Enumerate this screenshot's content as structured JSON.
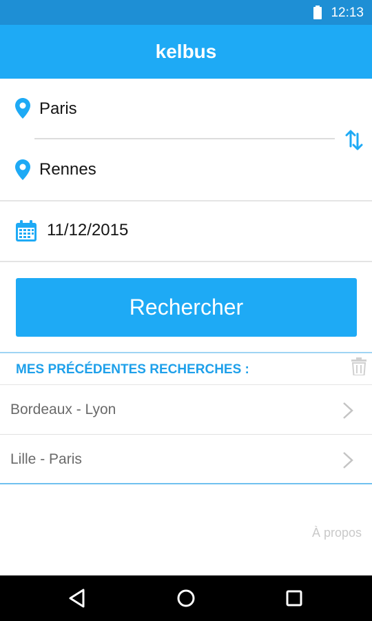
{
  "status_bar": {
    "time": "12:13",
    "battery_icon": "battery-full-icon"
  },
  "app": {
    "title": "kelbus"
  },
  "route": {
    "departure": {
      "value": "Paris",
      "icon": "location-pin-icon"
    },
    "arrival": {
      "value": "Rennes",
      "icon": "location-pin-icon"
    },
    "swap_icon": "swap-vertical-icon"
  },
  "date": {
    "value": "11/12/2015",
    "icon": "calendar-icon"
  },
  "search_button": {
    "label": "Rechercher"
  },
  "history": {
    "title": "MES PRÉCÉDENTES RECHERCHES :",
    "clear_icon": "trash-icon",
    "items": [
      {
        "label": "Bordeaux - Lyon",
        "icon": "chevron-right-icon"
      },
      {
        "label": "Lille - Paris",
        "icon": "chevron-right-icon"
      }
    ]
  },
  "about": {
    "label": "À propos"
  },
  "nav_bar": {
    "back_icon": "back-triangle-icon",
    "home_icon": "home-circle-icon",
    "recents_icon": "recents-square-icon"
  },
  "colors": {
    "status_bar": "#1e8fd5",
    "accent": "#1eaaf5",
    "accent_text": "#1ea0ea",
    "nav_bar": "#000000",
    "muted_text": "#6a6a6a"
  }
}
